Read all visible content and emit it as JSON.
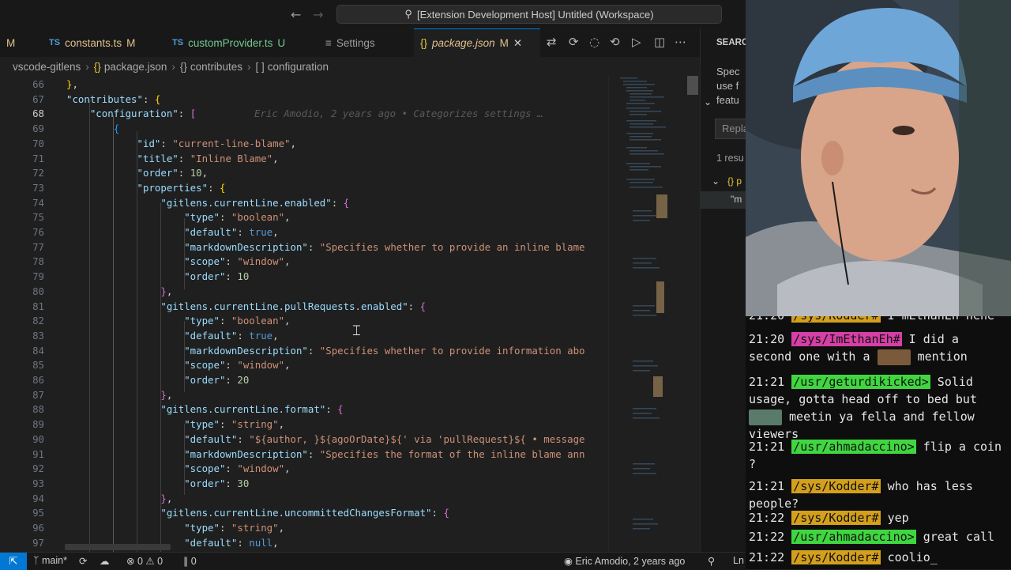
{
  "titlebar": {
    "back_icon": "arrow-left-icon",
    "forward_icon": "arrow-right-icon",
    "command_center": "[Extension Development Host] Untitled (Workspace)"
  },
  "tabs": [
    {
      "label": "M",
      "truncated": true
    },
    {
      "label": "constants.ts",
      "type": "TS",
      "status": "M"
    },
    {
      "label": "customProvider.ts",
      "type": "TS",
      "status": "U"
    },
    {
      "label": "Settings"
    },
    {
      "label": "package.json",
      "type": "{}",
      "status": "M"
    }
  ],
  "breadcrumb": [
    "vscode-gitlens",
    "package.json",
    "contributes",
    "configuration"
  ],
  "editor": {
    "blame_annotation": "Eric Amodio, 2 years ago • Categorizes settings …",
    "lines": [
      {
        "n": "66",
        "text": "    },"
      },
      {
        "n": "67",
        "text": "    \"contributes\": {"
      },
      {
        "n": "68",
        "text": "        \"configuration\": ["
      },
      {
        "n": "69",
        "text": "            {"
      },
      {
        "n": "70",
        "text": "                \"id\": \"current-line-blame\","
      },
      {
        "n": "71",
        "text": "                \"title\": \"Inline Blame\","
      },
      {
        "n": "72",
        "text": "                \"order\": 10,"
      },
      {
        "n": "73",
        "text": "                \"properties\": {"
      },
      {
        "n": "74",
        "text": "                    \"gitlens.currentLine.enabled\": {"
      },
      {
        "n": "75",
        "text": "                        \"type\": \"boolean\","
      },
      {
        "n": "76",
        "text": "                        \"default\": true,"
      },
      {
        "n": "77",
        "text": "                        \"markdownDescription\": \"Specifies whether to provide an inline blame"
      },
      {
        "n": "78",
        "text": "                        \"scope\": \"window\","
      },
      {
        "n": "79",
        "text": "                        \"order\": 10"
      },
      {
        "n": "80",
        "text": "                    },"
      },
      {
        "n": "81",
        "text": "                    \"gitlens.currentLine.pullRequests.enabled\": {"
      },
      {
        "n": "82",
        "text": "                        \"type\": \"boolean\","
      },
      {
        "n": "83",
        "text": "                        \"default\": true,"
      },
      {
        "n": "84",
        "text": "                        \"markdownDescription\": \"Specifies whether to provide information abo"
      },
      {
        "n": "85",
        "text": "                        \"scope\": \"window\","
      },
      {
        "n": "86",
        "text": "                        \"order\": 20"
      },
      {
        "n": "87",
        "text": "                    },"
      },
      {
        "n": "88",
        "text": "                    \"gitlens.currentLine.format\": {"
      },
      {
        "n": "89",
        "text": "                        \"type\": \"string\","
      },
      {
        "n": "90",
        "text": "                        \"default\": \"${author, }${agoOrDate}${' via 'pullRequest}${ • message"
      },
      {
        "n": "91",
        "text": "                        \"markdownDescription\": \"Specifies the format of the inline blame ann"
      },
      {
        "n": "92",
        "text": "                        \"scope\": \"window\","
      },
      {
        "n": "93",
        "text": "                        \"order\": 30"
      },
      {
        "n": "94",
        "text": "                    },"
      },
      {
        "n": "95",
        "text": "                    \"gitlens.currentLine.uncommittedChangesFormat\": {"
      },
      {
        "n": "96",
        "text": "                        \"type\": \"string\","
      },
      {
        "n": "97",
        "text": "                        \"default\": null,"
      }
    ]
  },
  "search_panel": {
    "title": "SEARC",
    "snippet": [
      "Spec",
      "use f",
      "featu"
    ],
    "replace_placeholder": "Repla",
    "results": "1 resu",
    "tree_item": "{} p",
    "match": "\"m"
  },
  "statusbar": {
    "branch": "main*",
    "errors": "0",
    "warnings": "0",
    "ports": "0",
    "blame": "Eric Amodio, 2 years ago",
    "position": "Ln"
  },
  "chat": [
    {
      "time": "21:20",
      "user": "/sys/Kodder#",
      "color": "orange",
      "text": "I'mEthanEh hehe",
      "clipped": true
    },
    {
      "time": "21:20",
      "user": "/sys/ImEthanEh#",
      "color": "pink",
      "text": "I did a second one with a",
      "emote": true,
      "text2": "mention"
    },
    {
      "time": "21:21",
      "user": "/usr/geturdikicked>",
      "color": "green",
      "text": "Solid usage, gotta head off to bed but",
      "emote_line": true,
      "text2": "meetin ya fella and fellow viewers"
    },
    {
      "time": "21:21",
      "user": "/usr/ahmadaccino>",
      "color": "green",
      "text": "flip a coin ?"
    },
    {
      "time": "21:21",
      "user": "/sys/Kodder#",
      "color": "orange",
      "text": "who has less people?"
    },
    {
      "time": "21:22",
      "user": "/sys/Kodder#",
      "color": "orange",
      "text": "yep"
    },
    {
      "time": "21:22",
      "user": "/usr/ahmadaccino>",
      "color": "green",
      "text": "great call"
    },
    {
      "time": "21:22",
      "user": "/sys/Kodder#",
      "color": "orange",
      "text": "coolio_"
    }
  ]
}
